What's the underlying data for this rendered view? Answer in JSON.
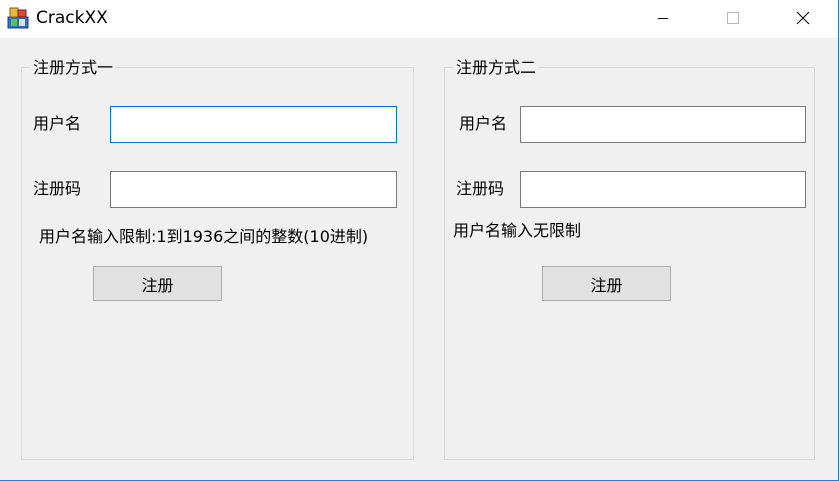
{
  "window": {
    "title": "CrackXX",
    "icon": "mfc-app-icon",
    "controls": {
      "minimize": "minimize-icon",
      "maximize": "maximize-icon",
      "close": "close-icon"
    }
  },
  "group1": {
    "title": "注册方式一",
    "username_label": "用户名",
    "username_value": "",
    "code_label": "注册码",
    "code_value": "",
    "hint": "用户名输入限制:1到1936之间的整数(10进制)",
    "register_label": "注册"
  },
  "group2": {
    "title": "注册方式二",
    "username_label": "用户名",
    "username_value": "",
    "code_label": "注册码",
    "code_value": "",
    "hint": "用户名输入无限制",
    "register_label": "注册"
  },
  "colors": {
    "window_bg": "#f0f0f0",
    "focus_border": "#0078d7",
    "button_bg": "#e1e1e1"
  }
}
